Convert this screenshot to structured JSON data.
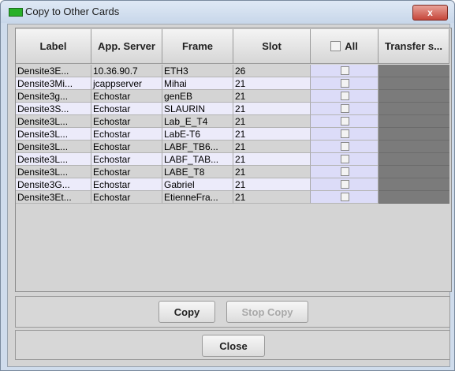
{
  "window": {
    "title": "Copy to Other Cards",
    "close_symbol": "x"
  },
  "table": {
    "columns": [
      "Label",
      "App. Server",
      "Frame",
      "Slot",
      "All",
      "Transfer s..."
    ],
    "rows": [
      {
        "label": "Densite3E...",
        "server": "10.36.90.7",
        "frame": "ETH3",
        "slot": "26"
      },
      {
        "label": "Densite3Mi...",
        "server": "jcappserver",
        "frame": "Mihai",
        "slot": "21"
      },
      {
        "label": "Densite3g...",
        "server": "Echostar",
        "frame": "genEB",
        "slot": "21"
      },
      {
        "label": "Densite3S...",
        "server": "Echostar",
        "frame": "SLAURIN",
        "slot": "21"
      },
      {
        "label": "Densite3L...",
        "server": "Echostar",
        "frame": "Lab_E_T4",
        "slot": "21"
      },
      {
        "label": "Densite3L...",
        "server": "Echostar",
        "frame": "LabE-T6",
        "slot": "21"
      },
      {
        "label": "Densite3L...",
        "server": "Echostar",
        "frame": "LABF_TB6...",
        "slot": "21"
      },
      {
        "label": "Densite3L...",
        "server": "Echostar",
        "frame": "LABF_TAB...",
        "slot": "21"
      },
      {
        "label": "Densite3L...",
        "server": "Echostar",
        "frame": "LABE_T8",
        "slot": "21"
      },
      {
        "label": "Densite3G...",
        "server": "Echostar",
        "frame": "Gabriel",
        "slot": "21"
      },
      {
        "label": "Densite3Et...",
        "server": "Echostar",
        "frame": "EtienneFra...",
        "slot": "21"
      }
    ]
  },
  "buttons": {
    "copy": "Copy",
    "stop_copy": "Stop Copy",
    "close": "Close"
  },
  "colors": {
    "row_even": "#d4d4d4",
    "row_odd": "#ecebfa",
    "check_column": "#dcdcf8",
    "transfer_column": "#7b7b7b"
  }
}
